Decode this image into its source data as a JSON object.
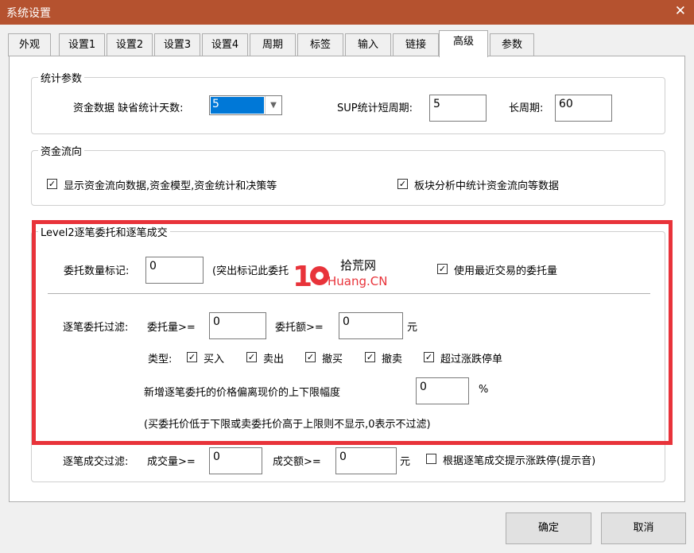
{
  "window": {
    "title": "系统设置",
    "close": "✕"
  },
  "tabs": [
    "外观",
    "设置1",
    "设置2",
    "设置3",
    "设置4",
    "周期",
    "标签",
    "输入",
    "链接",
    "高级",
    "参数"
  ],
  "stats": {
    "group": "统计参数",
    "missing_days_label": "资金数据 缺省统计天数:",
    "missing_days_value": "5",
    "sup_label": "SUP统计短周期:",
    "sup_value": "5",
    "long_label": "长周期:",
    "long_value": "60"
  },
  "flow": {
    "group": "资金流向",
    "cb1": "显示资金流向数据,资金模型,资金统计和决策等",
    "cb2": "板块分析中统计资金流向等数据"
  },
  "level2": {
    "group": "Level2逐笔委托和逐笔成交",
    "mark_label": "委托数量标记:",
    "mark_value": "0",
    "mark_hint": "(突出标记此委托",
    "use_recent": "使用最近交易的委托量",
    "filter_label": "逐笔委托过滤:",
    "qty_label": "委托量>=",
    "qty_value": "0",
    "amt_label": "委托额>=",
    "amt_value": "0",
    "unit": "元",
    "type_label": "类型:",
    "types": [
      "买入",
      "卖出",
      "撤买",
      "撤卖",
      "超过涨跌停单"
    ],
    "deviation_label": "新增逐笔委托的价格偏离现价的上下限幅度",
    "deviation_value": "0",
    "percent": "%",
    "note": "(买委托价低于下限或卖委托价高于上限则不显示,0表示不过滤)",
    "deal_label": "逐笔成交过滤:",
    "vol_label": "成交量>=",
    "vol_value": "0",
    "deal_amt_label": "成交额>=",
    "deal_amt_value": "0",
    "deal_unit": "元",
    "deal_tip": "根据逐笔成交提示涨跌停(提示音)"
  },
  "watermark": {
    "line1": "拾荒网",
    "line2": "Huang.CN"
  },
  "buttons": {
    "ok": "确定",
    "cancel": "取消"
  },
  "colors": {
    "titlebar": "#b5522f",
    "highlight": "#e8333a",
    "selection": "#0078d7"
  }
}
